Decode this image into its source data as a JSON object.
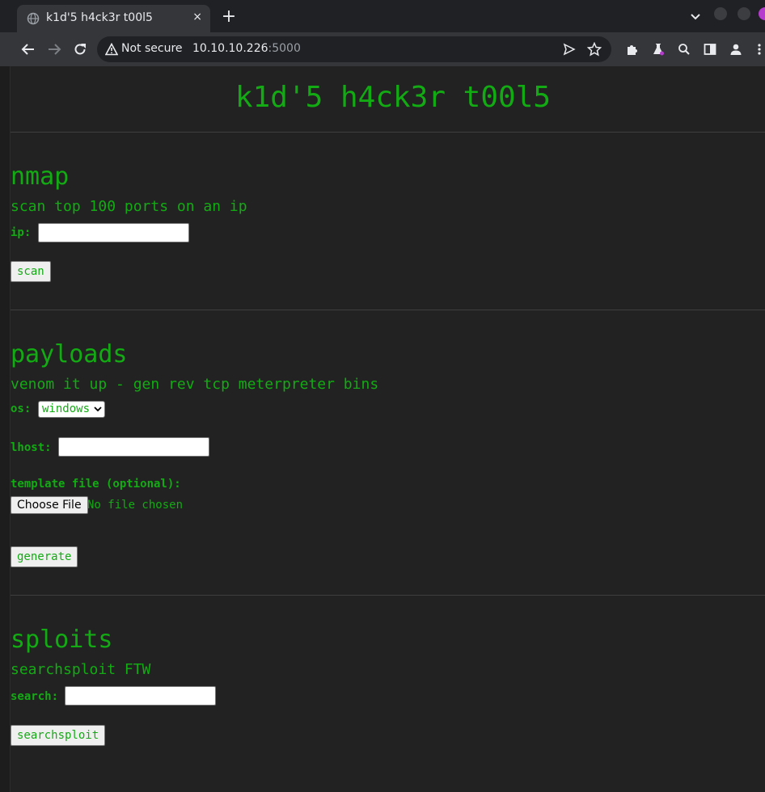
{
  "browser": {
    "tab_title": "k1d'5 h4ck3r t00l5",
    "tab_close": "×",
    "new_tab": "+",
    "security_label": "Not secure",
    "url_host": "10.10.10.226",
    "url_port": ":5000"
  },
  "page": {
    "title": "k1d'5 h4ck3r t00l5",
    "nmap": {
      "heading": "nmap",
      "description": "scan top 100 ports on an ip",
      "ip_label": "ip:",
      "ip_value": "",
      "button": "scan"
    },
    "payloads": {
      "heading": "payloads",
      "description": "venom it up - gen rev tcp meterpreter bins",
      "os_label": "os:",
      "os_selected": "windows",
      "lhost_label": "lhost:",
      "lhost_value": "",
      "template_label": "template file (optional):",
      "file_button": "Choose File",
      "file_status": "No file chosen",
      "button": "generate"
    },
    "sploits": {
      "heading": "sploits",
      "description": "searchsploit FTW",
      "search_label": "search:",
      "search_value": "",
      "button": "searchsploit"
    }
  },
  "colors": {
    "accent_green": "#13ab13",
    "background": "#222222",
    "chrome_dark": "#202124",
    "chrome_toolbar": "#35363a"
  },
  "icons": [
    "globe-icon",
    "close-icon",
    "plus-icon",
    "chevron-down-icon",
    "back-icon",
    "forward-icon",
    "reload-icon",
    "warning-icon",
    "send-icon",
    "star-icon",
    "puzzle-icon",
    "flask-icon",
    "search-icon",
    "sidebar-icon",
    "profile-icon",
    "kebab-menu-icon"
  ]
}
